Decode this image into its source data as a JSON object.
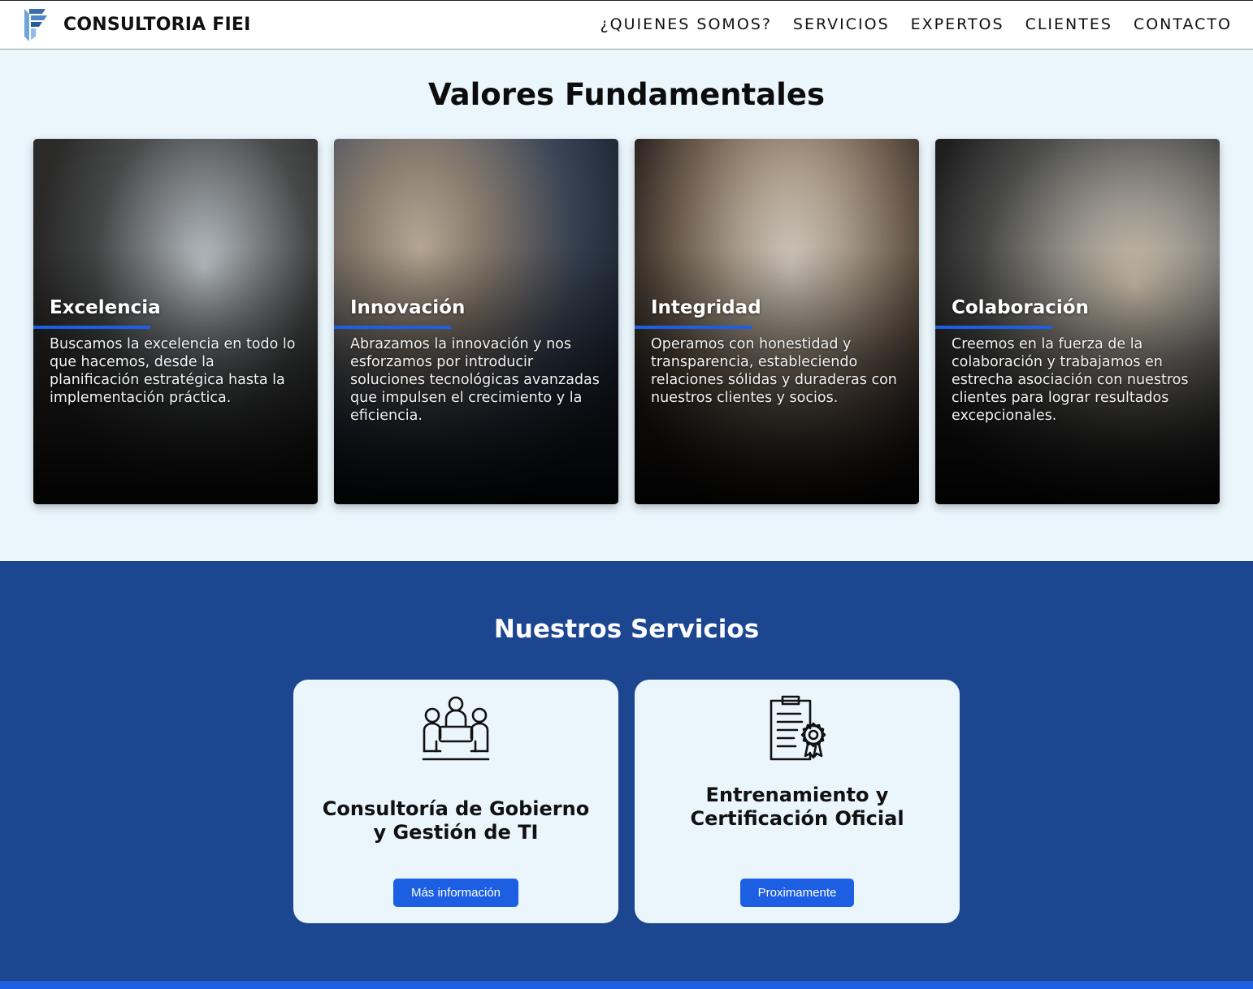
{
  "header": {
    "brand": "CONSULTORIA FIEI",
    "nav": [
      "¿QUIENES SOMOS?",
      "SERVICIOS",
      "EXPERTOS",
      "CLIENTES",
      "CONTACTO"
    ]
  },
  "values": {
    "title": "Valores Fundamentales",
    "cards": [
      {
        "title": "Excelencia",
        "text": "Buscamos la excelencia en todo lo que hacemos, desde la planificación estratégica hasta la implementación práctica."
      },
      {
        "title": "Innovación",
        "text": "Abrazamos la innovación y nos esforzamos por introducir soluciones tecnológicas avanzadas que impulsen el crecimiento y la eficiencia."
      },
      {
        "title": "Integridad",
        "text": "Operamos con honestidad y transparencia, estableciendo relaciones sólidas y duraderas con nuestros clientes y socios."
      },
      {
        "title": "Colaboración",
        "text": "Creemos en la fuerza de la colaboración y trabajamos en estrecha asociación con nuestros clientes para lograr resultados excepcionales."
      }
    ]
  },
  "services": {
    "title": "Nuestros Servicios",
    "items": [
      {
        "title": "Consultoría de Gobierno y Gestión de TI",
        "button": "Más información",
        "icon": "meeting-table-icon"
      },
      {
        "title": "Entrenamiento y Certificación Oficial",
        "button": "Proximamente",
        "icon": "certificate-icon"
      }
    ]
  },
  "colors": {
    "accent": "#1c5fe3",
    "services_bg": "#1c4690",
    "page_bg": "#eaf5fc"
  }
}
